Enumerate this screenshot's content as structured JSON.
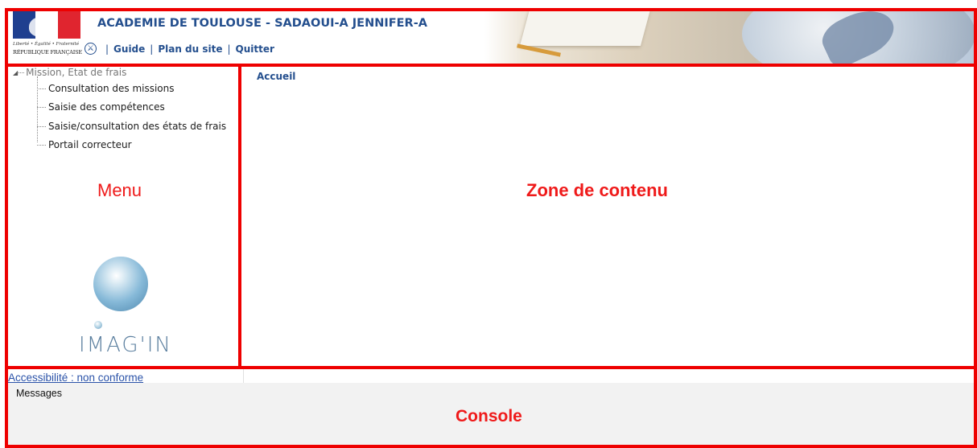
{
  "header": {
    "title": "ACADEMIE DE TOULOUSE - SADAOUI-A JENNIFER-A",
    "logo": {
      "motto": "Liberté • Égalité • Fraternité",
      "name": "RÉPUBLIQUE FRANÇAISE"
    },
    "toolbar": {
      "separator": "|",
      "guide_label": "Guide",
      "sitemap_label": "Plan du site",
      "quit_label": "Quitter"
    }
  },
  "menu": {
    "root_label": "Mission, Etat de frais",
    "items": [
      {
        "label": "Consultation des missions"
      },
      {
        "label": "Saisie des compétences"
      },
      {
        "label": "Saisie/consultation des états de frais"
      },
      {
        "label": "Portail correcteur"
      }
    ],
    "logo_text": "IMAG'IN"
  },
  "content": {
    "breadcrumb": "Accueil"
  },
  "accessibility": {
    "status_link": "Accessibilité : non conforme"
  },
  "console": {
    "title": "Messages"
  },
  "annotations": {
    "menu": "Menu",
    "content": "Zone de contenu",
    "console": "Console",
    "color": "#ee0000"
  }
}
